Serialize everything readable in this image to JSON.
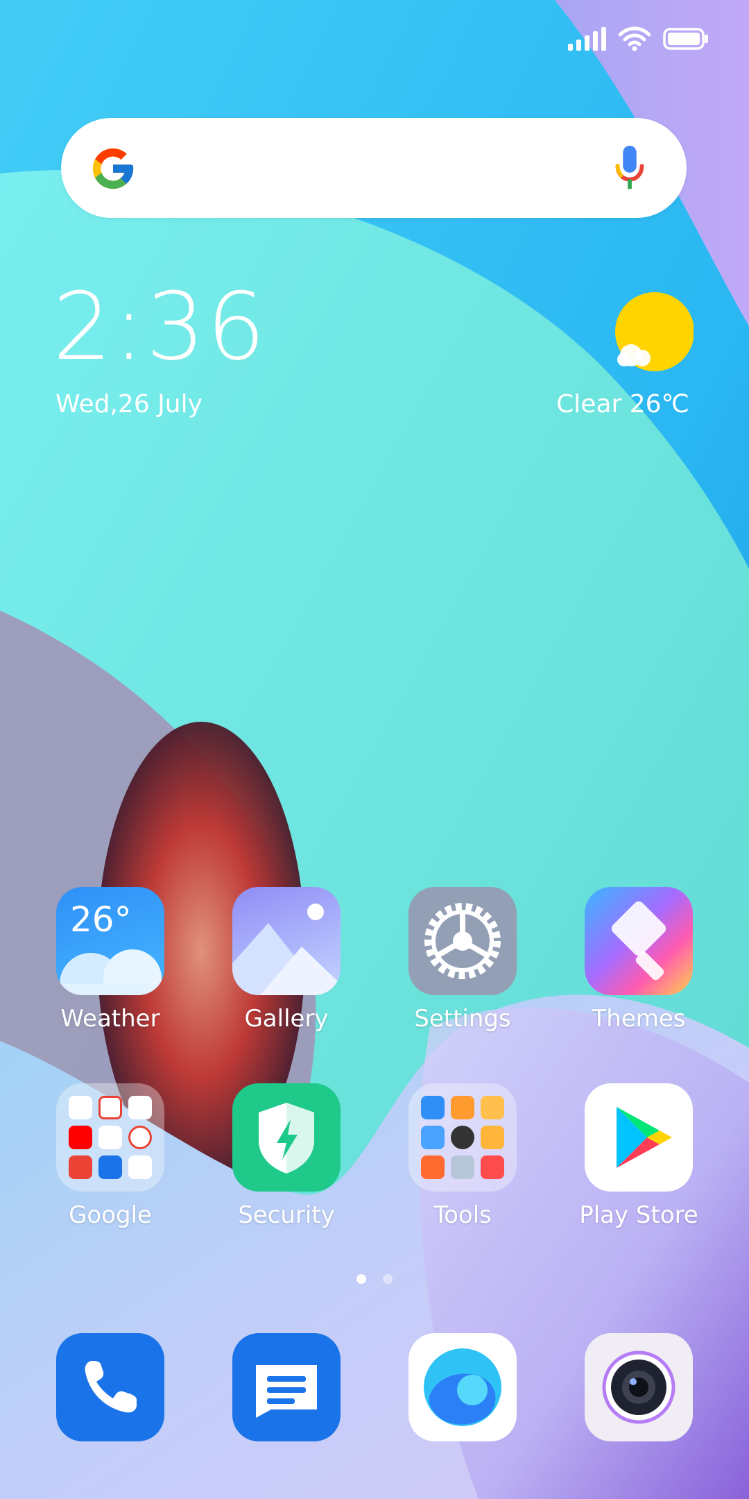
{
  "status_bar": {
    "signal_icon": "signal-bars-icon",
    "wifi_icon": "wifi-icon",
    "battery_icon": "battery-icon"
  },
  "search_bar": {
    "logo_icon": "google-g-icon",
    "mic_icon": "microphone-icon"
  },
  "clock_widget": {
    "time": "2:36",
    "date": "Wed,26 July"
  },
  "weather_widget": {
    "icon": "sun-cloud-icon",
    "text": "Clear 26℃"
  },
  "apps": [
    {
      "label": "Weather",
      "icon": "weather-app-icon",
      "badge": "26°"
    },
    {
      "label": "Gallery",
      "icon": "gallery-app-icon"
    },
    {
      "label": "Settings",
      "icon": "settings-gear-icon"
    },
    {
      "label": "Themes",
      "icon": "themes-brush-icon"
    },
    {
      "label": "Google",
      "icon": "google-folder-icon"
    },
    {
      "label": "Security",
      "icon": "security-shield-icon"
    },
    {
      "label": "Tools",
      "icon": "tools-folder-icon"
    },
    {
      "label": "Play Store",
      "icon": "play-store-icon"
    }
  ],
  "page_indicator": {
    "pages": 2,
    "current": 1
  },
  "dock": [
    {
      "icon": "phone-icon"
    },
    {
      "icon": "messages-icon"
    },
    {
      "icon": "browser-icon"
    },
    {
      "icon": "camera-icon"
    }
  ],
  "colors": {
    "sky": "#3ec7f0",
    "teal": "#6ae3df",
    "lavender": "#c7b6f7",
    "weather_yellow": "#ffd400",
    "dock_blue": "#1a73e8",
    "security_green": "#1fc98a"
  }
}
